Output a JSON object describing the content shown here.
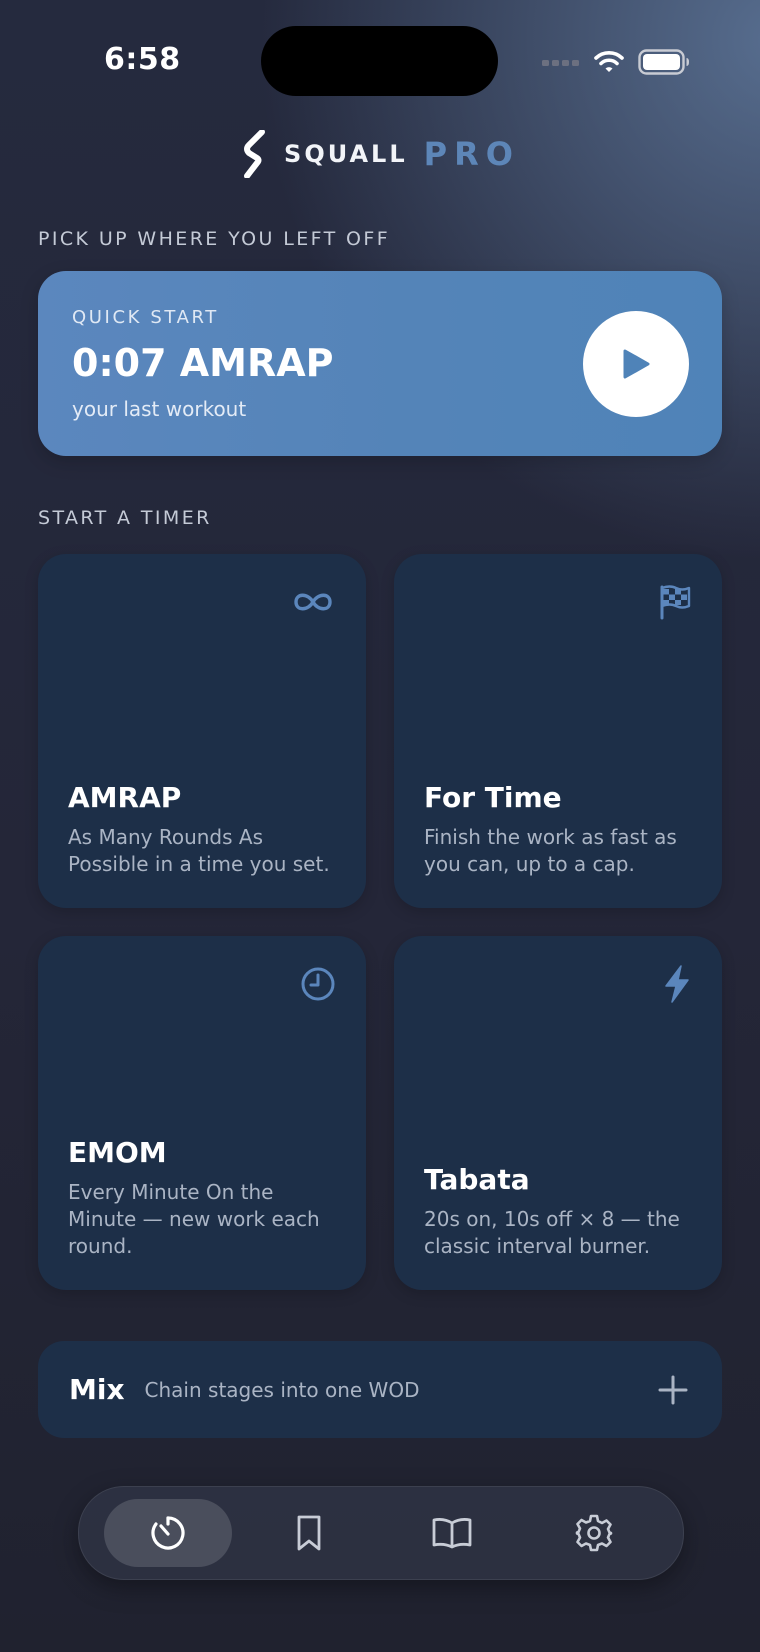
{
  "status_bar": {
    "time": "6:58"
  },
  "brand": {
    "name": "SQUALL",
    "tier": "PRO",
    "accent_color": "#5d86b8"
  },
  "resume": {
    "section_label": "PICK UP WHERE YOU LEFT OFF",
    "eyebrow": "QUICK START",
    "title": "0:07 AMRAP",
    "subtitle": "your last workout"
  },
  "timers": {
    "section_label": "START A TIMER",
    "cards": [
      {
        "icon": "infinity-icon",
        "title": "AMRAP",
        "description": "As Many Rounds As Possible in a time you set."
      },
      {
        "icon": "checkered-flag-icon",
        "title": "For Time",
        "description": "Finish the work as fast as you can, up to a cap."
      },
      {
        "icon": "clock-icon",
        "title": "EMOM",
        "description": "Every Minute On the Minute — new work each round."
      },
      {
        "icon": "lightning-icon",
        "title": "Tabata",
        "description": "20s on, 10s off × 8 — the classic interval burner."
      }
    ]
  },
  "mix": {
    "title": "Mix",
    "subtitle": "Chain stages into one WOD"
  },
  "tab_bar": {
    "tabs": [
      {
        "icon": "stopwatch-icon",
        "active": true
      },
      {
        "icon": "bookmark-icon",
        "active": false
      },
      {
        "icon": "book-icon",
        "active": false
      },
      {
        "icon": "gear-icon",
        "active": false
      }
    ]
  },
  "colors": {
    "card_background": "#1d2f48",
    "quick_start_background": "#5484b8",
    "icon_accent": "#5b86bc"
  }
}
